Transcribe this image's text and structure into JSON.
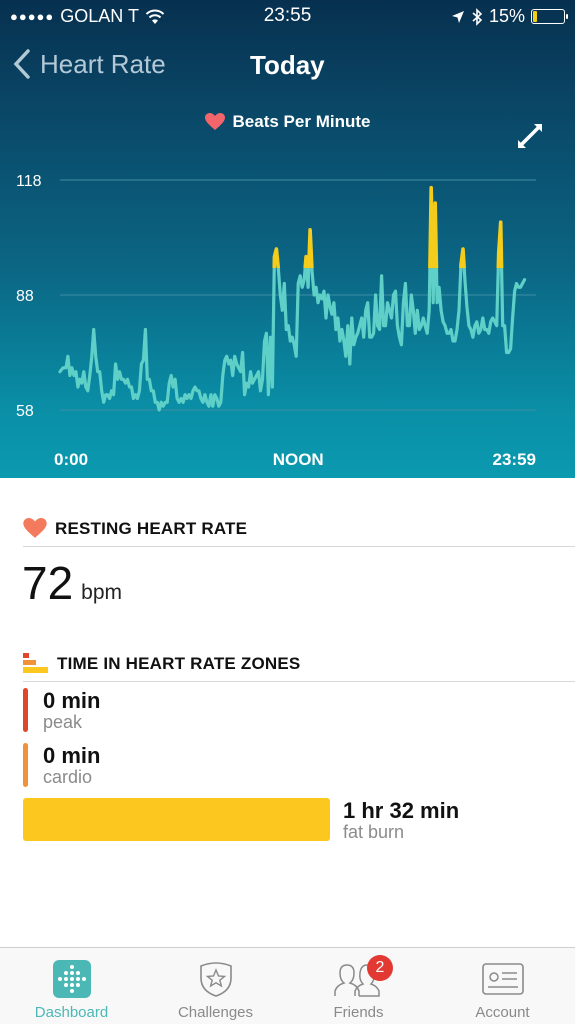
{
  "status_bar": {
    "signal_dots": "●●●●●",
    "carrier": "GOLAN T",
    "wifi_icon": "wifi-icon",
    "time": "23:55",
    "location_icon": "location-arrow-icon",
    "bluetooth_icon": "bluetooth-icon",
    "battery_percent": "15%",
    "battery_level": 0.15,
    "battery_color": "#f5d019"
  },
  "nav": {
    "back_label": "Heart Rate",
    "title": "Today"
  },
  "chart_header": {
    "legend_label": "Beats Per Minute",
    "legend_icon": "heart-icon",
    "expand_icon": "expand-icon"
  },
  "chart_data": {
    "type": "line",
    "title": "Beats Per Minute",
    "xlabel": "",
    "ylabel": "",
    "x_unit": "hours since midnight",
    "x_tick_labels": [
      "0:00",
      "NOON",
      "23:59"
    ],
    "x_ticks": [
      0,
      12,
      23.98
    ],
    "xlim": [
      0,
      23.98
    ],
    "y_tick_labels": [
      "118",
      "88",
      "58"
    ],
    "y_ticks": [
      118,
      88,
      58
    ],
    "ylim": [
      58,
      118
    ],
    "grid": true,
    "legend": "top-center",
    "highlight_threshold_bpm": 95,
    "colors": {
      "normal": "#5fd0c8",
      "fat_burn_zone": "#f4cc1c",
      "grid": "#3f8ea4"
    },
    "series": [
      {
        "name": "Heart Rate",
        "x": [
          0.0,
          0.15,
          0.3,
          0.4,
          0.5,
          0.6,
          0.7,
          0.8,
          0.9,
          1.0,
          1.1,
          1.2,
          1.3,
          1.4,
          1.5,
          1.6,
          1.7,
          1.8,
          1.9,
          2.0,
          2.1,
          2.2,
          2.3,
          2.4,
          2.5,
          2.6,
          2.7,
          2.8,
          2.9,
          3.0,
          3.1,
          3.2,
          3.3,
          3.4,
          3.5,
          3.6,
          3.7,
          3.8,
          3.9,
          4.0,
          4.1,
          4.2,
          4.3,
          4.4,
          4.5,
          4.6,
          4.7,
          4.8,
          4.9,
          5.0,
          5.1,
          5.2,
          5.3,
          5.4,
          5.5,
          5.6,
          5.7,
          5.8,
          5.9,
          6.0,
          6.1,
          6.2,
          6.3,
          6.4,
          6.5,
          6.6,
          6.7,
          6.8,
          6.9,
          7.0,
          7.1,
          7.2,
          7.3,
          7.4,
          7.5,
          7.6,
          7.7,
          7.8,
          7.9,
          8.0,
          8.1,
          8.2,
          8.3,
          8.4,
          8.5,
          8.6,
          8.7,
          8.8,
          8.9,
          9.0,
          9.1,
          9.2,
          9.3,
          9.4,
          9.5,
          9.6,
          9.7,
          9.8,
          9.9,
          10.0,
          10.1,
          10.2,
          10.3,
          10.4,
          10.5,
          10.6,
          10.7,
          10.8,
          10.9,
          11.0,
          11.1,
          11.2,
          11.3,
          11.4,
          11.5,
          11.6,
          11.7,
          11.8,
          11.9,
          12.0,
          12.1,
          12.2,
          12.3,
          12.4,
          12.5,
          12.6,
          12.7,
          12.8,
          12.9,
          13.0,
          13.1,
          13.2,
          13.3,
          13.4,
          13.5,
          13.6,
          13.7,
          13.8,
          13.9,
          14.0,
          14.1,
          14.2,
          14.3,
          14.4,
          14.5,
          14.6,
          14.7,
          14.8,
          14.9,
          15.0,
          15.1,
          15.2,
          15.3,
          15.4,
          15.5,
          15.6,
          15.7,
          15.8,
          15.9,
          16.0,
          16.1,
          16.2,
          16.3,
          16.4,
          16.5,
          16.6,
          16.7,
          16.8,
          16.9,
          17.0,
          17.1,
          17.2,
          17.3,
          17.4,
          17.5,
          17.6,
          17.7,
          17.8,
          17.9,
          18.0,
          18.1,
          18.2,
          18.3,
          18.4,
          18.5,
          18.6,
          18.7,
          18.8,
          18.9,
          19.0,
          19.1,
          19.2,
          19.3,
          19.4,
          19.5,
          19.6,
          19.7,
          19.8,
          19.9,
          20.0,
          20.1,
          20.2,
          20.3,
          20.4,
          20.5,
          20.6,
          20.7,
          20.8,
          20.9,
          21.0,
          21.1,
          21.2,
          21.3,
          21.4,
          21.5,
          21.6,
          21.7,
          21.8,
          21.9,
          22.0,
          22.1,
          22.2,
          22.3,
          22.4,
          22.5,
          22.6,
          22.7,
          22.8,
          22.9,
          23.0,
          23.1,
          23.2,
          23.3,
          23.4,
          23.5,
          23.6
        ],
        "values": [
          68,
          69,
          69,
          72,
          67,
          69,
          67,
          68,
          64,
          66,
          65,
          68,
          64,
          63,
          67,
          72,
          79,
          72,
          68,
          68,
          63,
          60,
          62,
          62,
          61,
          63,
          62,
          70,
          66,
          68,
          66,
          66,
          65,
          66,
          64,
          64,
          61,
          62,
          61,
          63,
          70,
          71,
          79,
          66,
          66,
          63,
          63,
          60,
          60,
          58,
          60,
          59,
          60,
          60,
          65,
          67,
          64,
          66,
          61,
          60,
          61,
          60,
          62,
          61,
          62,
          61,
          63,
          64,
          63,
          63,
          61,
          60,
          62,
          60,
          59,
          62,
          59,
          62,
          61,
          59,
          60,
          67,
          71,
          72,
          70,
          71,
          67,
          72,
          70,
          69,
          68,
          73,
          62,
          65,
          64,
          68,
          65,
          66,
          67,
          68,
          63,
          66,
          76,
          78,
          62,
          77,
          64,
          98,
          100,
          95,
          88,
          84,
          91,
          79,
          80,
          76,
          77,
          75,
          72,
          91,
          93,
          90,
          92,
          98,
          90,
          105,
          94,
          88,
          90,
          86,
          88,
          87,
          89,
          82,
          88,
          85,
          83,
          86,
          79,
          82,
          76,
          79,
          76,
          72,
          80,
          70,
          82,
          75,
          77,
          78,
          80,
          82,
          77,
          84,
          86,
          77,
          77,
          78,
          88,
          80,
          79,
          93,
          80,
          80,
          86,
          84,
          82,
          88,
          89,
          80,
          77,
          75,
          86,
          91,
          80,
          80,
          88,
          84,
          78,
          84,
          79,
          80,
          82,
          80,
          78,
          84,
          116,
          86,
          112,
          86,
          90,
          84,
          81,
          80,
          78,
          78,
          79,
          76,
          76,
          79,
          84,
          96,
          100,
          92,
          85,
          80,
          79,
          77,
          80,
          81,
          78,
          79,
          82,
          79,
          79,
          78,
          81,
          82,
          81,
          80,
          99,
          107,
          80,
          80,
          73,
          73,
          74,
          82,
          89,
          91,
          90,
          90,
          91,
          92
        ]
      }
    ]
  },
  "resting": {
    "icon": "heart-icon",
    "title": "RESTING HEART RATE",
    "value": "72",
    "unit": "bpm"
  },
  "zones": {
    "icon": "zones-bars-icon",
    "title": "TIME IN HEART RATE ZONES",
    "items": [
      {
        "value": "0 min",
        "label": "peak",
        "color": "#e0462c"
      },
      {
        "value": "0 min",
        "label": "cardio",
        "color": "#f0923a"
      },
      {
        "value": "1 hr 32 min",
        "label": "fat burn",
        "color": "#fcc81f"
      }
    ]
  },
  "tabbar": {
    "items": [
      {
        "label": "Dashboard",
        "icon": "dashboard-icon",
        "active": true
      },
      {
        "label": "Challenges",
        "icon": "challenges-shield-star-icon",
        "active": false
      },
      {
        "label": "Friends",
        "icon": "friends-icon",
        "active": false,
        "badge": "2"
      },
      {
        "label": "Account",
        "icon": "account-card-icon",
        "active": false
      }
    ],
    "active_color": "#4cb8b5"
  }
}
